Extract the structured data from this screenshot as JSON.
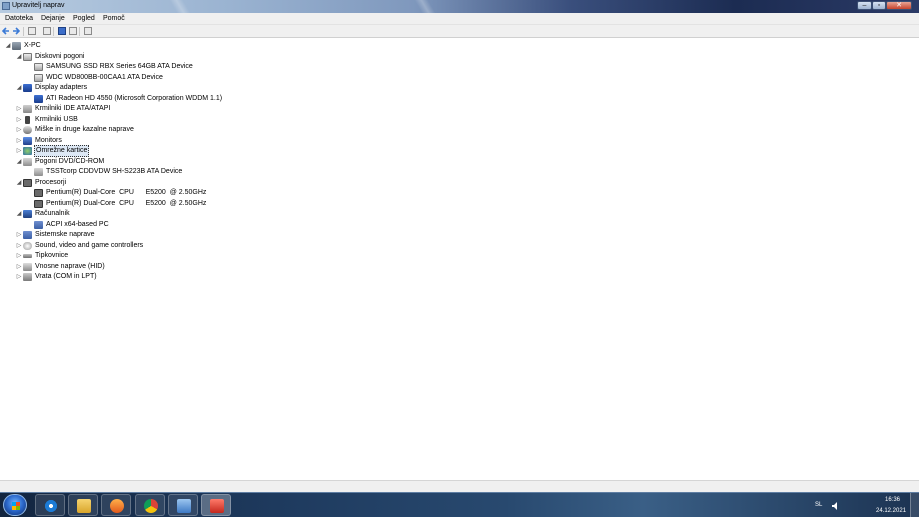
{
  "window": {
    "title": "Upravitelj naprav"
  },
  "menu": [
    "Datoteka",
    "Dejanje",
    "Pogled",
    "Pomoč"
  ],
  "tree": {
    "root": "X-PC",
    "categories": [
      {
        "label": "Diskovni pogoni",
        "expanded": true,
        "icon": "disk-icon",
        "children": [
          "SAMSUNG SSD RBX Series 64GB ATA Device",
          "WDC WD800BB-00CAA1 ATA Device"
        ]
      },
      {
        "label": "Display adapters",
        "expanded": true,
        "icon": "display-adapter-icon",
        "children": [
          "ATI Radeon HD 4550 (Microsoft Corporation WDDM 1.1)"
        ]
      },
      {
        "label": "Krmilniki IDE ATA/ATAPI",
        "expanded": false,
        "icon": "ide-controller-icon",
        "children": []
      },
      {
        "label": "Krmilniki USB",
        "expanded": false,
        "icon": "usb-icon",
        "children": []
      },
      {
        "label": "Miške in druge kazalne naprave",
        "expanded": false,
        "icon": "mouse-icon",
        "children": []
      },
      {
        "label": "Monitors",
        "expanded": false,
        "icon": "monitor-icon",
        "children": []
      },
      {
        "label": "Omrežne kartice",
        "expanded": false,
        "selected": true,
        "icon": "network-adapter-icon",
        "children": []
      },
      {
        "label": "Pogoni DVD/CD-ROM",
        "expanded": true,
        "icon": "dvd-drive-icon",
        "children": [
          "TSSTcorp CDDVDW SH-S223B ATA Device"
        ]
      },
      {
        "label": "Procesorji",
        "expanded": true,
        "icon": "processor-icon",
        "children": [
          "Pentium(R) Dual-Core  CPU      E5200  @ 2.50GHz",
          "Pentium(R) Dual-Core  CPU      E5200  @ 2.50GHz"
        ]
      },
      {
        "label": "Računalnik",
        "expanded": true,
        "icon": "computer-icon",
        "children": [
          "ACPI x64-based PC"
        ]
      },
      {
        "label": "Sistemske naprave",
        "expanded": false,
        "icon": "system-devices-icon",
        "children": []
      },
      {
        "label": "Sound, video and game controllers",
        "expanded": false,
        "icon": "sound-icon",
        "children": []
      },
      {
        "label": "Tipkovnice",
        "expanded": false,
        "icon": "keyboard-icon",
        "children": []
      },
      {
        "label": "Vnosne naprave (HID)",
        "expanded": false,
        "icon": "hid-icon",
        "children": []
      },
      {
        "label": "Vrata (COM in LPT)",
        "expanded": false,
        "icon": "port-icon",
        "children": []
      }
    ]
  },
  "taskbar": {
    "apps": [
      "internet-explorer-icon",
      "explorer-folder-icon",
      "media-player-icon",
      "chrome-icon",
      "control-panel-icon",
      "device-manager-icon"
    ],
    "language": "SL",
    "time": "16:36",
    "date": "24.12.2021"
  }
}
